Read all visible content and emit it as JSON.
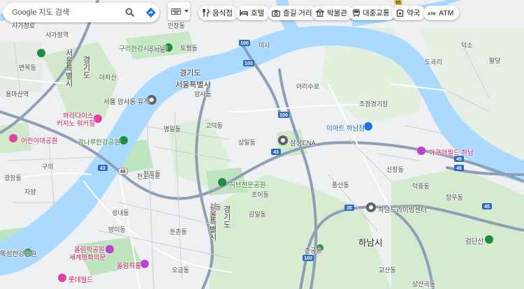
{
  "search": {
    "placeholder": "Google 지도 검색"
  },
  "chips": [
    {
      "label": "음식점",
      "icon": "restaurant-icon"
    },
    {
      "label": "호텔",
      "icon": "hotel-icon"
    },
    {
      "label": "즐길 거리",
      "icon": "camera-icon"
    },
    {
      "label": "박물관",
      "icon": "museum-icon"
    },
    {
      "label": "대중교통",
      "icon": "transit-icon"
    },
    {
      "label": "약국",
      "icon": "pharmacy-icon"
    },
    {
      "label": "ATM",
      "icon": "atm-icon"
    }
  ],
  "places": {
    "guri_park": "구리한강시민공원",
    "gwangnaru_park": "광나루한강공원",
    "amsa": "서울 암사동 유적",
    "paradise1": "파라다이스",
    "paradise2": "커지노 워커힐",
    "children_park": "어린이대공원",
    "herbcheon": "허브천문공원",
    "emart": "이마트 하남점",
    "samsung": "삼성ENA",
    "aqua": "아쿠아필드 하남",
    "hanam_drive": "하남드라이빙센터",
    "geomdan": "검단산",
    "olympic1": "올림픽공원",
    "olympic2": "세계평화의문",
    "olympic_hall": "올림픽홀",
    "lotte": "롯데월드",
    "ttukseom": "뚝섬한강공원",
    "hanam": "하남시",
    "gyeonggi1": "경기도",
    "seoul1": "서울특별시",
    "gyeonggi2": "경기도",
    "seoul2": "서울특별시",
    "gyeonggi3": "경기도",
    "seoul3": "서울특별시",
    "gyeonggi4": "경기도"
  },
  "streets": [
    "사가정로",
    "사가정역",
    "면목동",
    "용마산역",
    "긴고랑로",
    "아차산",
    "구의",
    "광장동",
    "자양",
    "구의역",
    "아차산로",
    "천호대로",
    "강일동",
    "미사",
    "미사강변로",
    "아리수로",
    "신장동",
    "덕풍동",
    "창우동",
    "풍산동",
    "감일동",
    "고덕동",
    "명일동",
    "상일동",
    "암사동",
    "천호동",
    "성내동",
    "길동",
    "둔촌동",
    "방이동",
    "오금동",
    "송파",
    "잠실",
    "조정경기장",
    "미사경정공원",
    "하남대로",
    "초이동",
    "춘궁동",
    "교산동",
    "상산곡동",
    "강동대로",
    "동남로",
    "올림픽로",
    "구천면로",
    "망우로",
    "덕소",
    "팔당",
    "도곡리",
    "수석동",
    "토평동",
    "인창동",
    "교문동",
    "아천동",
    "이세로",
    "백제고분로",
    "강동역"
  ],
  "roads": [
    "43",
    "43",
    "45",
    "45",
    "45",
    "43",
    "35",
    "100",
    "100",
    "100",
    "100",
    "88",
    "88",
    "88",
    "88",
    "88",
    "55",
    "35"
  ],
  "colors": {
    "river": "#aadaff",
    "urban": "#e8eaed",
    "park": "#c6e8c3",
    "forest": "#d5ecd0",
    "highway": "#8f9fb6",
    "pink_poi": "#e040a0",
    "green_poi": "#1e8e3e",
    "gray_poi": "#5f6368",
    "blue_poi": "#1a73e8"
  }
}
